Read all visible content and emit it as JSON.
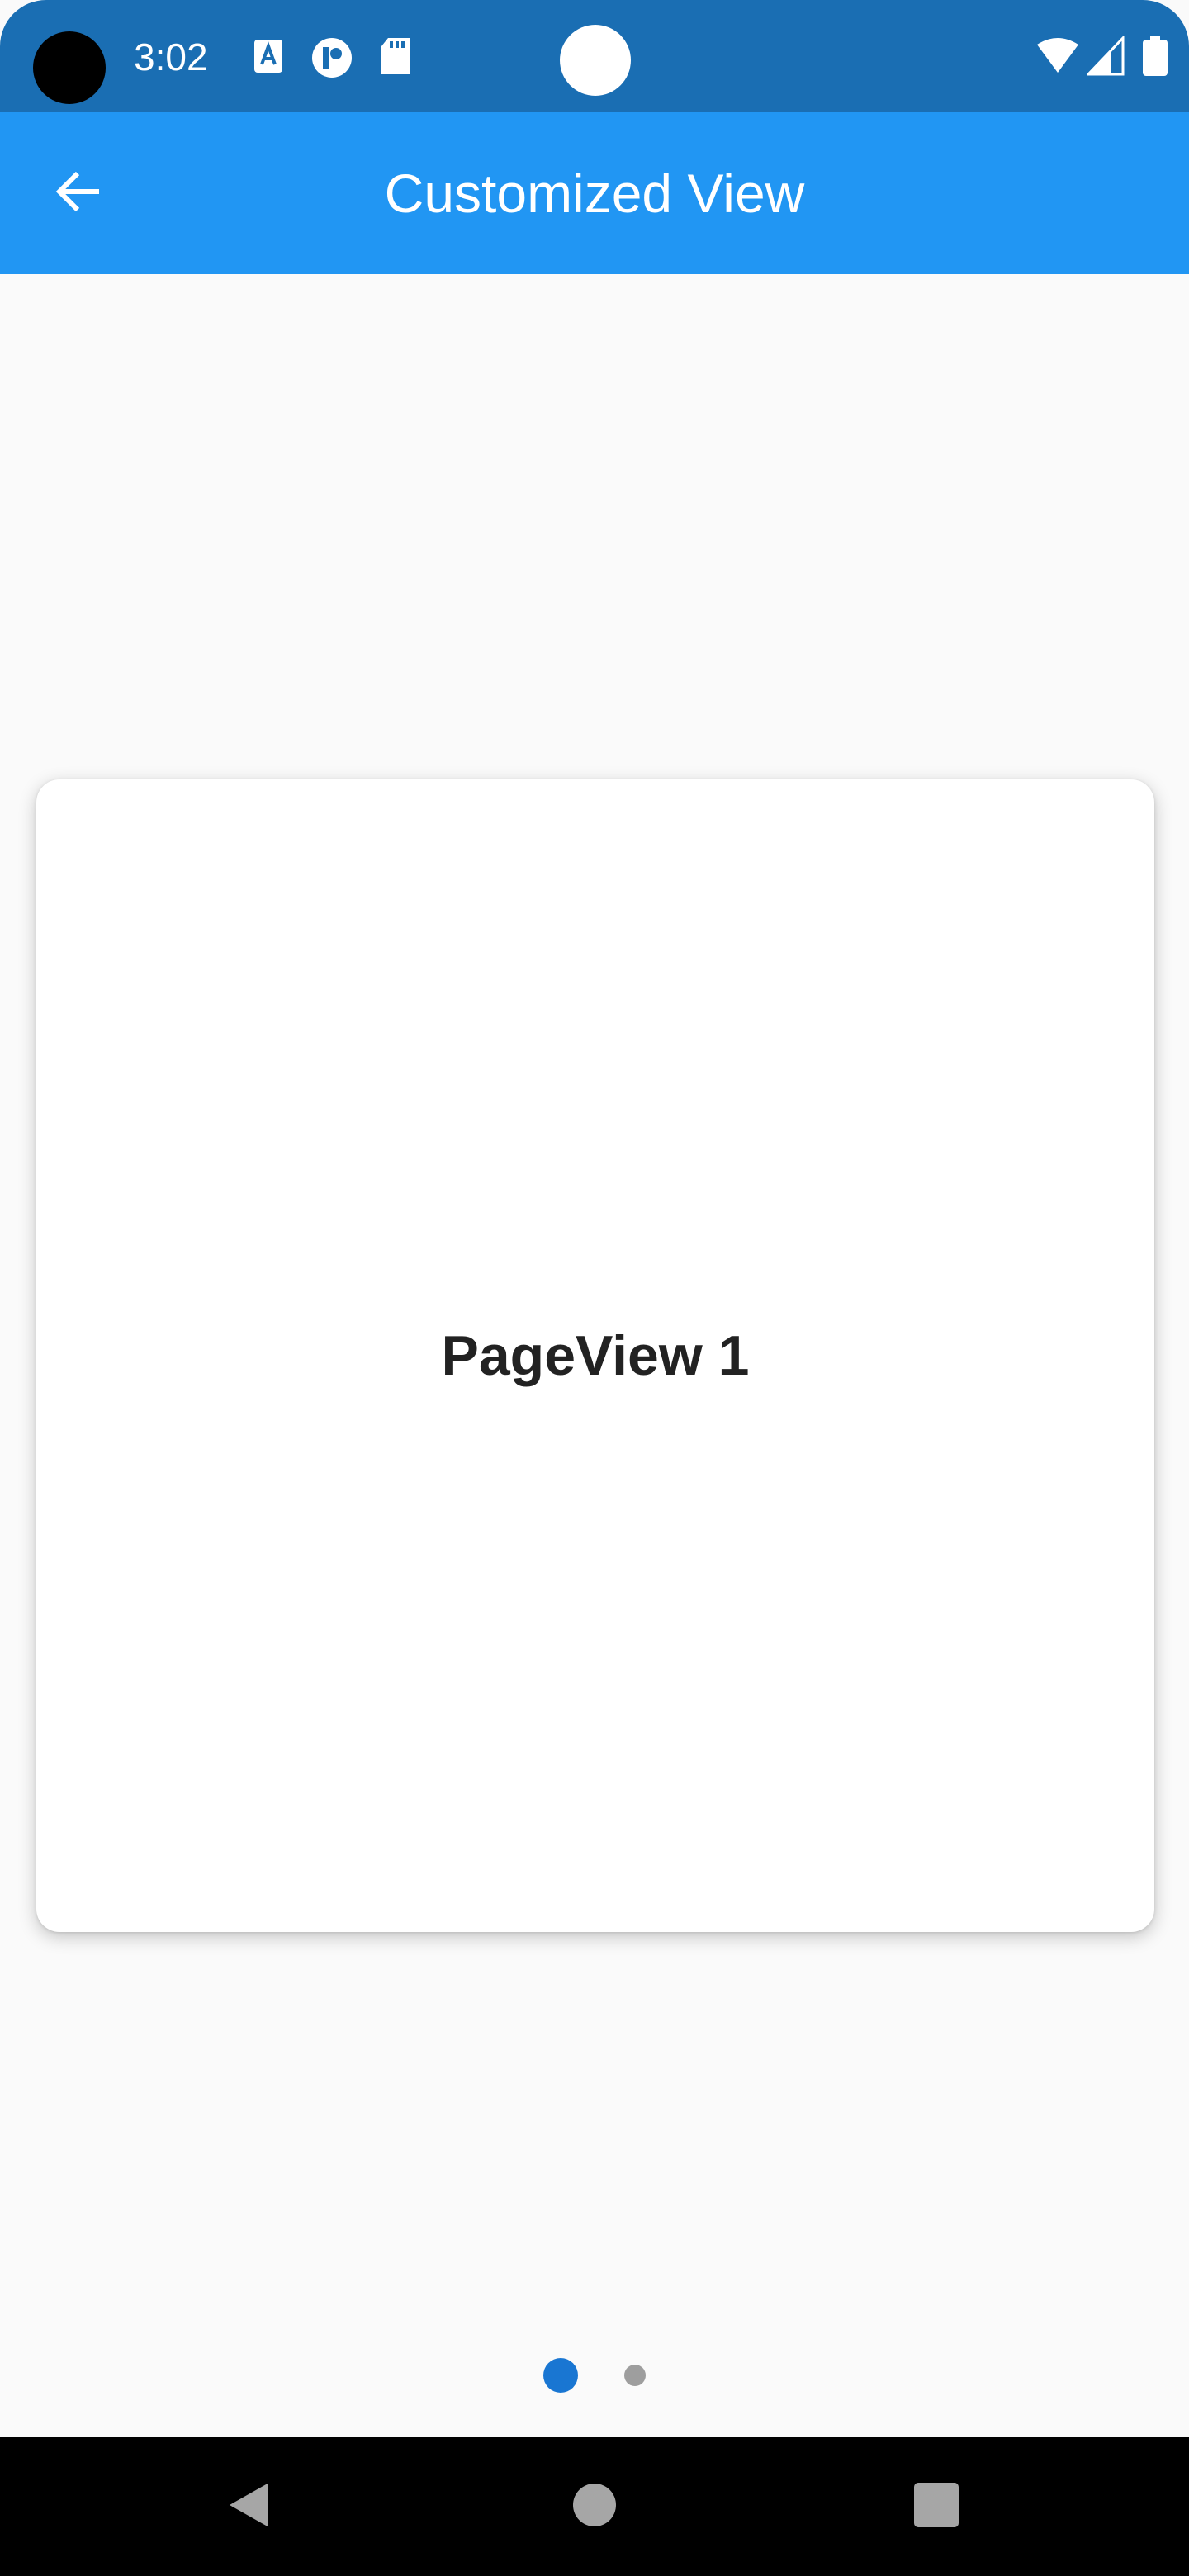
{
  "status_bar": {
    "time": "3:02",
    "icons": [
      "font-a-icon",
      "p-app-icon",
      "sd-card-icon",
      "wifi-icon",
      "cellular-signal-icon",
      "battery-icon"
    ],
    "color": "#1a6eb3"
  },
  "app_bar": {
    "title": "Customized View",
    "back_icon": "arrow-back-icon",
    "color": "#2196f3"
  },
  "page_view": {
    "current_label": "PageView 1",
    "page_count": 2,
    "current_index": 0,
    "active_dot_color": "#1976d2",
    "inactive_dot_color": "#9e9e9e"
  },
  "nav_bar": {
    "buttons": [
      "back-triangle-icon",
      "home-circle-icon",
      "recents-square-icon"
    ]
  }
}
